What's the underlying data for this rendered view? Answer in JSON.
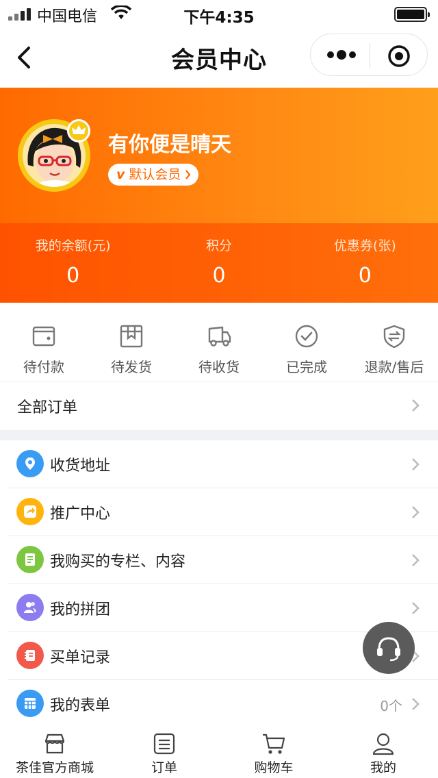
{
  "status_bar": {
    "carrier": "中国电信",
    "time": "下午4:35"
  },
  "navbar": {
    "title": "会员中心",
    "back_icon": "chevron-left-icon",
    "more_icon": "more-dots-icon",
    "target_icon": "record-target-icon"
  },
  "profile": {
    "name": "有你便是晴天",
    "member_level": "默认会员",
    "member_prefix": "v"
  },
  "stats": [
    {
      "label": "我的余额(元)",
      "value": "0"
    },
    {
      "label": "积分",
      "value": "0"
    },
    {
      "label": "优惠券(张)",
      "value": "0"
    }
  ],
  "order_status": [
    {
      "label": "待付款",
      "icon": "wallet-icon"
    },
    {
      "label": "待发货",
      "icon": "box-icon"
    },
    {
      "label": "待收货",
      "icon": "truck-icon"
    },
    {
      "label": "已完成",
      "icon": "check-circle-icon"
    },
    {
      "label": "退款/售后",
      "icon": "shield-refund-icon"
    }
  ],
  "all_orders": {
    "label": "全部订单"
  },
  "menu": [
    {
      "label": "收货地址",
      "icon": "location-pin-icon",
      "color": "#3a9bf4"
    },
    {
      "label": "推广中心",
      "icon": "share-arrow-icon",
      "color": "#ffb30f"
    },
    {
      "label": "我购买的专栏、内容",
      "icon": "document-icon",
      "color": "#7dc642"
    },
    {
      "label": "我的拼团",
      "icon": "group-users-icon",
      "color": "#8c7cf0"
    },
    {
      "label": "买单记录",
      "icon": "receipt-icon",
      "color": "#f2594b"
    },
    {
      "label": "我的表单",
      "icon": "form-grid-icon",
      "color": "#3a9bf4",
      "count": "0个"
    }
  ],
  "tabs": [
    {
      "label": "茶佳官方商城",
      "icon": "shop-icon"
    },
    {
      "label": "订单",
      "icon": "order-list-icon"
    },
    {
      "label": "购物车",
      "icon": "cart-icon"
    },
    {
      "label": "我的",
      "icon": "user-icon"
    }
  ],
  "floating_service_icon": "headset-icon"
}
